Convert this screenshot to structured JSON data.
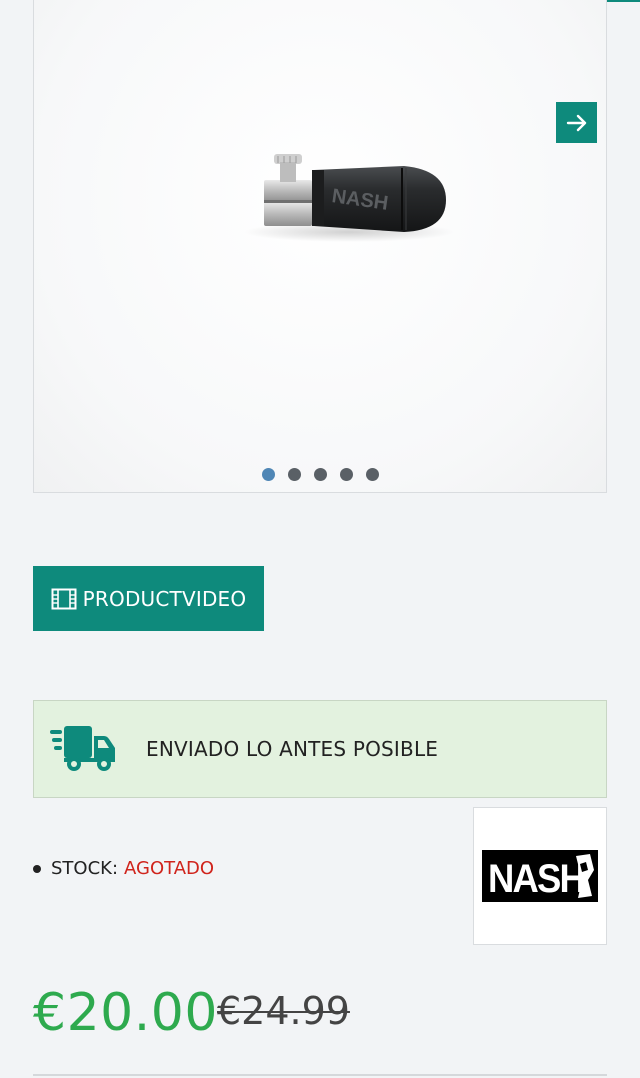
{
  "gallery": {
    "total_slides": 5,
    "active_slide": 1,
    "next_icon": "arrow-right-icon",
    "product_name_on_image": "NASH"
  },
  "video_button": {
    "label": "PRODUCTVIDEO",
    "icon": "film-icon"
  },
  "shipping": {
    "text": "ENVIADO LO ANTES POSIBLE",
    "icon": "truck-icon"
  },
  "stock": {
    "label": "STOCK:",
    "status": "AGOTADO"
  },
  "brand": {
    "name": "NASH"
  },
  "price": {
    "current": "€20.00",
    "original": "€24.99"
  },
  "colors": {
    "accent": "#0e8a7c",
    "price_green": "#2eaa4e",
    "out_of_stock_red": "#d0241c",
    "shipping_bg": "#e3f2df",
    "dot_active": "#4f86b5"
  }
}
